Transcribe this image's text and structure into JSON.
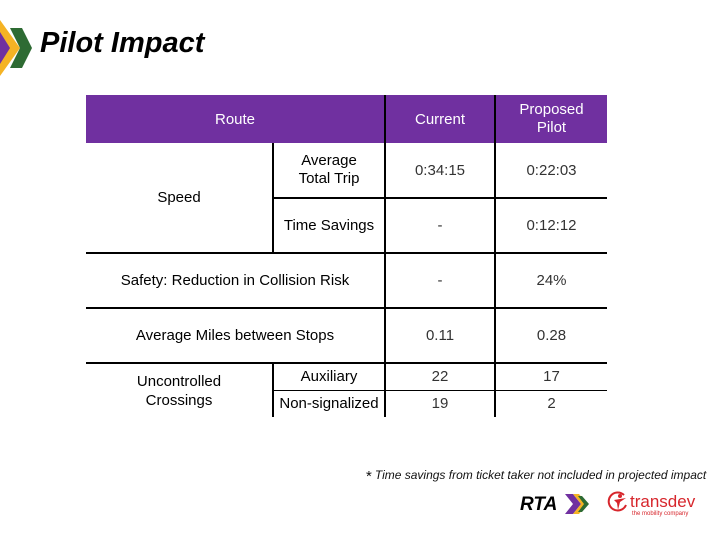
{
  "slide": {
    "title": "Pilot Impact",
    "logo_icon": "chevron-logo-icon"
  },
  "table": {
    "headers": {
      "route": "Route",
      "current": "Current",
      "proposed": "Proposed Pilot"
    },
    "speed": {
      "label": "Speed",
      "rows": [
        {
          "metric": "Average Total Trip",
          "current": "0:34:15",
          "proposed": "0:22:03"
        },
        {
          "metric": "Time Savings",
          "current": "-",
          "proposed": "0:12:12"
        }
      ]
    },
    "safety": {
      "label": "Safety: Reduction in Collision Risk",
      "current": "-",
      "proposed": "24%"
    },
    "miles": {
      "label": "Average Miles between Stops",
      "current": "0.11",
      "proposed": "0.28"
    },
    "crossings": {
      "label": "Uncontrolled Crossings",
      "rows": [
        {
          "metric": "Auxiliary",
          "current": "22",
          "proposed": "17"
        },
        {
          "metric": "Non-signalized",
          "current": "19",
          "proposed": "2"
        }
      ]
    }
  },
  "footnote": {
    "star": "*",
    "text": "Time savings from ticket taker not included in projected impact"
  },
  "logos": {
    "rta": "RTA",
    "transdev": "transdev",
    "transdev_tagline": "the mobility company"
  },
  "colors": {
    "header_bg": "#7030a0",
    "chevron_purple": "#7030a0",
    "chevron_orange": "#f5b324",
    "chevron_green": "#2e6b33",
    "transdev_red": "#d7262c"
  }
}
